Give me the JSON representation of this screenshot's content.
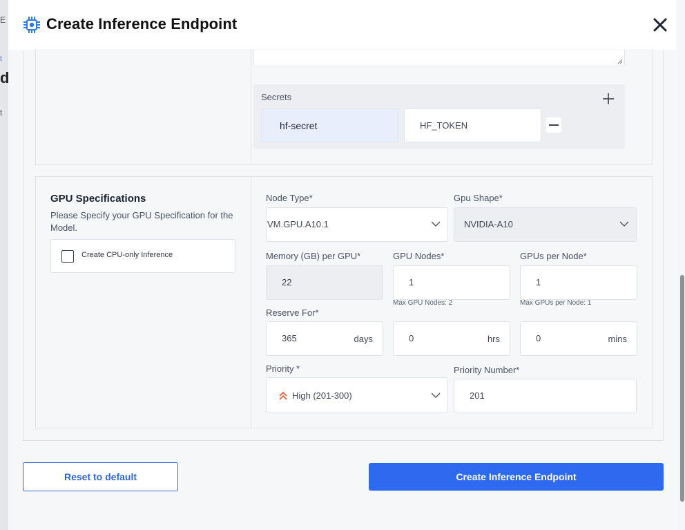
{
  "header": {
    "title": "Create Inference Endpoint",
    "logo_icon": "gear-chip-icon",
    "close_icon": "close-icon"
  },
  "backdrop": {
    "fragments": [
      "E",
      "t",
      "d",
      "t"
    ]
  },
  "secrets": {
    "label": "Secrets",
    "key_value": "hf-secret",
    "secret_value": "HF_TOKEN",
    "add_icon": "plus-icon",
    "remove_icon": "minus-icon"
  },
  "gpu": {
    "title": "GPU Specifications",
    "description": "Please Specify your GPU Specification for the Model.",
    "cpu_only_label": "Create CPU-only Inference",
    "node_type_label": "Node Type*",
    "node_type_value": "VM.GPU.A10.1",
    "gpu_shape_label": "Gpu Shape*",
    "gpu_shape_value": "NVIDIA-A10",
    "memory_label": "Memory (GB) per GPU*",
    "memory_value": "22",
    "gpu_nodes_label": "GPU Nodes*",
    "gpu_nodes_value": "1",
    "gpu_nodes_hint": "Max GPU Nodes: 2",
    "gpus_per_node_label": "GPUs per Node*",
    "gpus_per_node_value": "1",
    "gpus_per_node_hint": "Max GPUs per Node: 1",
    "reserve_label": "Reserve For*",
    "reserve_days_value": "365",
    "reserve_days_unit": "days",
    "reserve_hrs_value": "0",
    "reserve_hrs_unit": "hrs",
    "reserve_mins_value": "0",
    "reserve_mins_unit": "mins",
    "priority_label": "Priority *",
    "priority_value": "High (201-300)",
    "priority_icon": "double-chevron-up-icon",
    "priority_number_label": "Priority Number*",
    "priority_number_value": "201"
  },
  "footer": {
    "reset_label": "Reset to default",
    "create_label": "Create Inference Endpoint"
  },
  "colors": {
    "primary": "#2d6af0",
    "priority_high": "#e8603c",
    "logo": "#2d7be0"
  }
}
